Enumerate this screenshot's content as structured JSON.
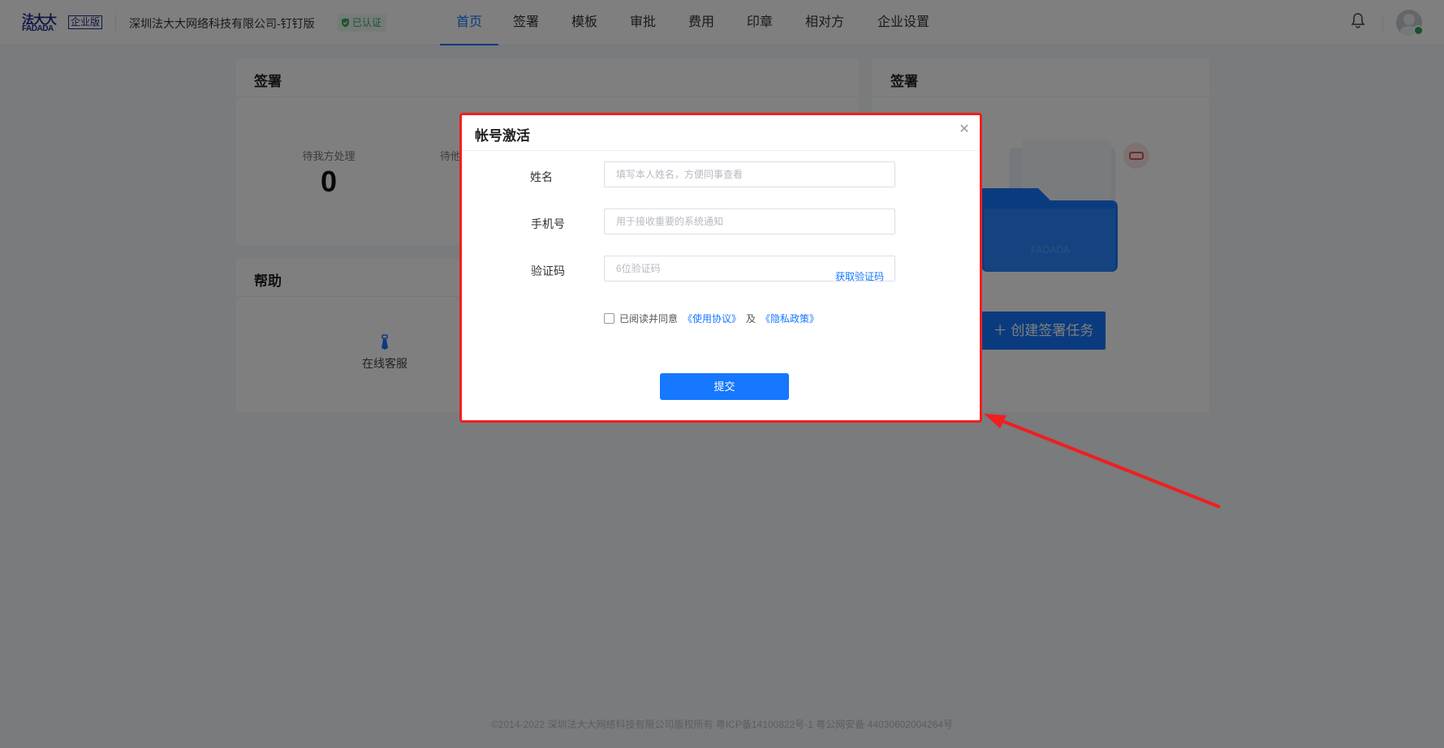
{
  "header": {
    "logo_cn": "法大大",
    "logo_en": "FADADA",
    "edition": "企业版",
    "company": "深圳法大大网络科技有限公司-钉钉版",
    "verified": "已认证",
    "nav": [
      "首页",
      "签署",
      "模板",
      "审批",
      "费用",
      "印章",
      "相对方",
      "企业设置"
    ],
    "active_nav": "首页"
  },
  "sign_card": {
    "title": "签署",
    "stats": [
      {
        "label": "待我方处理",
        "value": "0"
      },
      {
        "label": "待他",
        "value": ""
      }
    ]
  },
  "help_card": {
    "title": "帮助",
    "items": [
      {
        "label": "在线客服",
        "icon": "customer-service-icon"
      }
    ]
  },
  "right_card": {
    "title": "签署",
    "create_button": "创建签署任务",
    "illustration_text": "FADADA"
  },
  "footer": "©2014-2022 深圳法大大网络科技有限公司版权所有 粤ICP备14100822号-1 粤公网安备 44030602004264号",
  "modal": {
    "title": "帐号激活",
    "fields": {
      "name": {
        "label": "姓名",
        "placeholder": "填写本人姓名，方便同事查看",
        "value": ""
      },
      "phone": {
        "label": "手机号",
        "placeholder": "用于接收重要的系统通知",
        "value": ""
      },
      "code": {
        "label": "验证码",
        "placeholder": "6位验证码",
        "value": "",
        "action": "获取验证码"
      }
    },
    "agreement": {
      "text": "已阅读并同意",
      "terms": "《使用协议》",
      "conjunction": "及",
      "privacy": "《隐私政策》",
      "checked": false
    },
    "submit": "提交"
  },
  "colors": {
    "primary": "#1677ff",
    "highlight_border": "#f01e1e",
    "verified_green": "#3aa863"
  }
}
